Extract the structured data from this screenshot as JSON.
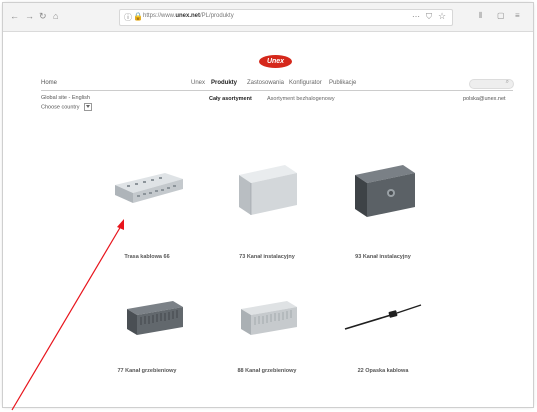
{
  "browser": {
    "nav_buttons": [
      "←",
      "→",
      "↻",
      "⌂"
    ],
    "url_scheme": "https://www.",
    "url_domain": "unex.net",
    "url_path": "/PL/produkty",
    "more_icon": "⋯",
    "right_icons": [
      "⫴",
      "▢",
      "≡"
    ]
  },
  "site": {
    "logo_text": "Unex",
    "home_link": "Home",
    "nav": [
      "Unex",
      "Produkty",
      "Zastosowania",
      "Konfigurator",
      "Publikacje"
    ],
    "search_placeholder": "",
    "site_language": "Global site - English",
    "choose_country": "Choose country",
    "subnav": [
      "Cały asortyment",
      "Asortyment bezhalogenowy"
    ],
    "email": "polska@unex.net"
  },
  "products": [
    {
      "label": "Trasa kablowa 66"
    },
    {
      "label": "73 Kanał instalacyjny"
    },
    {
      "label": "93 Kanał instalacyjny"
    },
    {
      "label": "77 Kanał grzebieniowy"
    },
    {
      "label": "88 Kanał grzebieniowy"
    },
    {
      "label": "22 Opaska kablowa"
    }
  ],
  "colors": {
    "brand_red": "#d5281b",
    "annotation_arrow": "#e8141c"
  }
}
